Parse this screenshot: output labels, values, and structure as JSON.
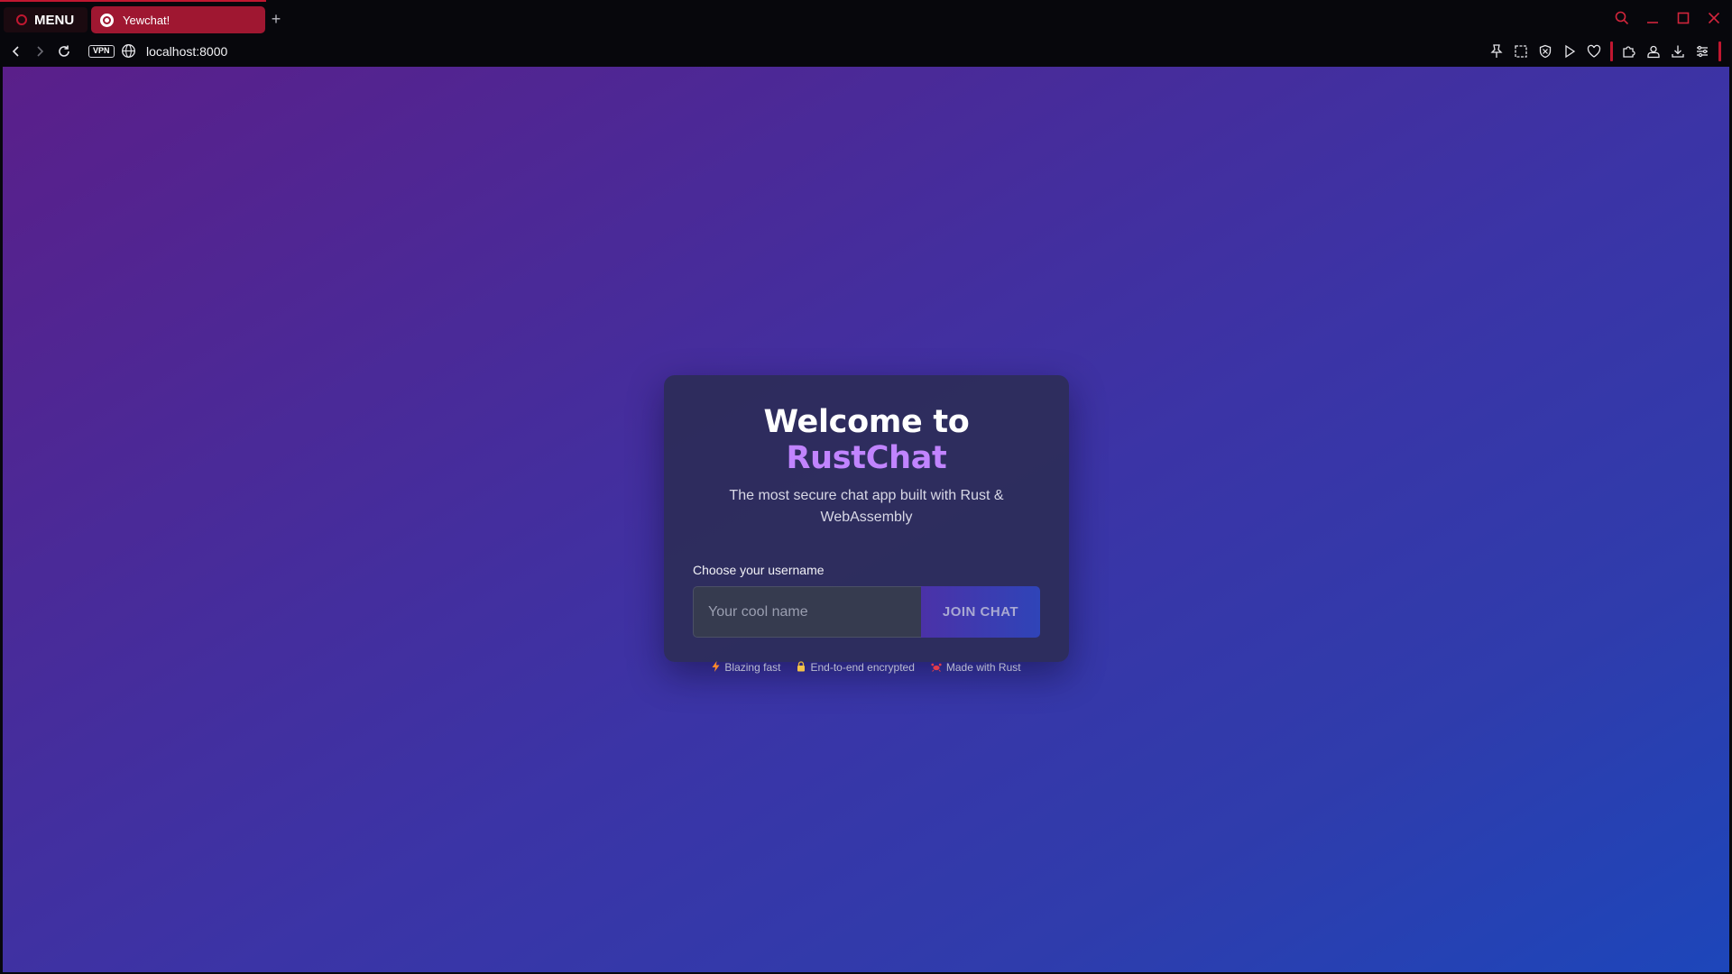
{
  "browser": {
    "menu_label": "MENU",
    "tab_title": "Yewchat!",
    "new_tab": "+",
    "vpn_label": "VPN",
    "url": "localhost:8000",
    "accent_color": "#c01730"
  },
  "page": {
    "title_prefix": "Welcome to ",
    "title_brand": "RustChat",
    "subtitle": "The most secure chat app built with Rust & WebAssembly",
    "username_label": "Choose your username",
    "username_placeholder": "Your cool name",
    "username_value": "",
    "join_button": "JOIN CHAT",
    "features": [
      {
        "icon": "lightning-icon",
        "label": "Blazing fast"
      },
      {
        "icon": "lock-icon",
        "label": "End-to-end encrypted"
      },
      {
        "icon": "crab-icon",
        "label": "Made with Rust"
      }
    ],
    "colors": {
      "brand": "#c184ff",
      "background_start": "#5a1f8a",
      "background_end": "#1d46ba",
      "card": "#2c2c58"
    }
  }
}
